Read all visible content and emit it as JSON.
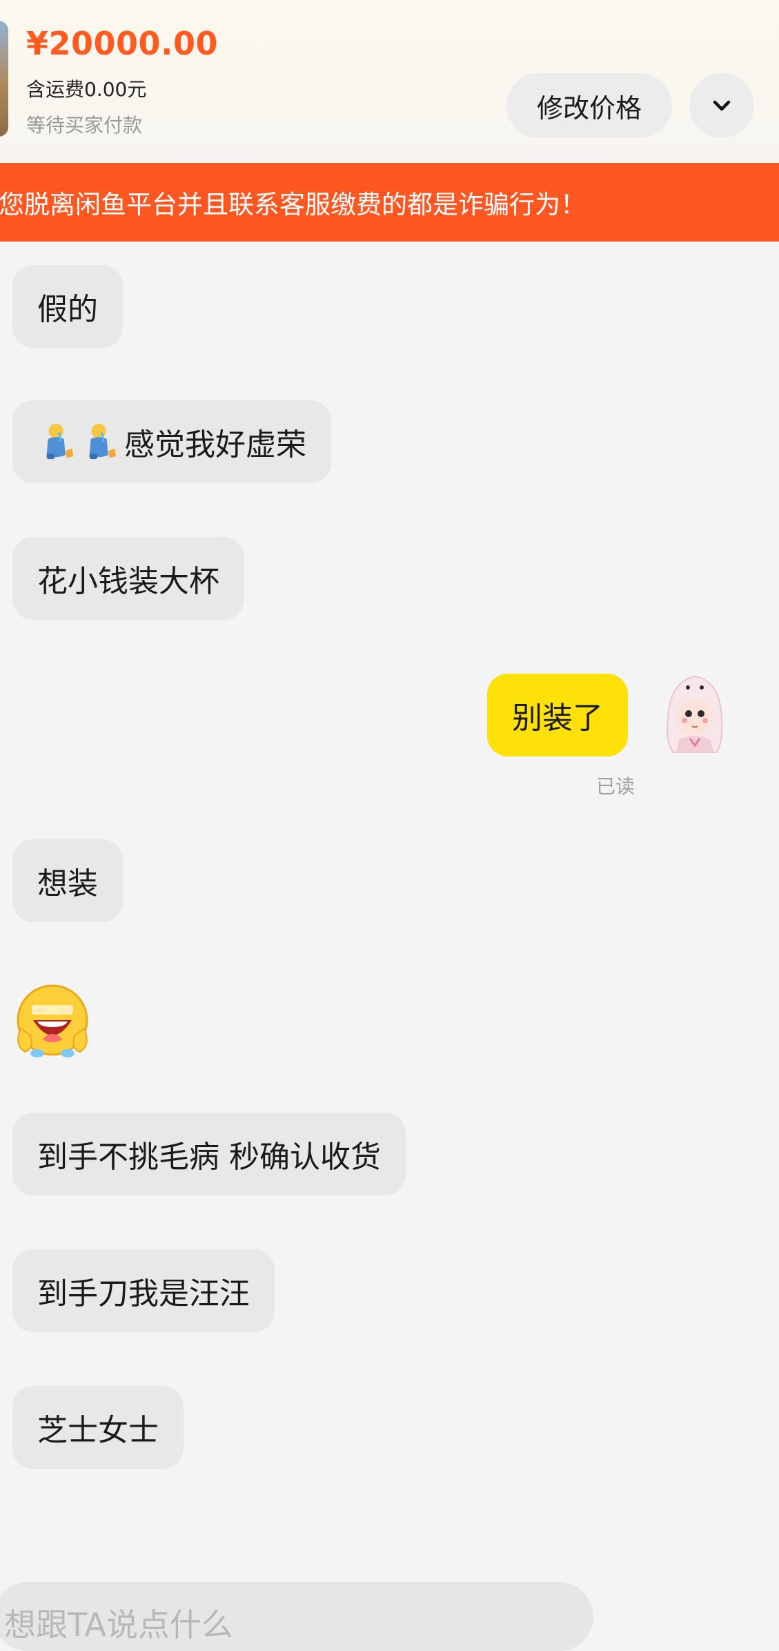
{
  "order": {
    "price": "¥20000.00",
    "shipping": "含运费0.00元",
    "status": "等待买家付款",
    "edit_price_label": "修改价格",
    "expand_icon": "chevron-down-icon"
  },
  "banner": {
    "text": "您脱离闲鱼平台并且联系客服缴费的都是诈骗行为！"
  },
  "messages": [
    {
      "side": "left",
      "text": "假的"
    },
    {
      "side": "left",
      "emoji": [
        "crying-person-emoji",
        "crying-person-emoji"
      ],
      "text": "感觉我好虚荣"
    },
    {
      "side": "left",
      "text": "花小钱装大杯"
    },
    {
      "side": "right",
      "text": "别装了",
      "receipt": "已读"
    },
    {
      "side": "left",
      "text": "想装"
    },
    {
      "side": "left",
      "emoji": [
        "grinning-tears-emoji"
      ]
    },
    {
      "side": "left",
      "text": "到手不挑毛病 秒确认收货"
    },
    {
      "side": "left",
      "text": "到手刀我是汪汪"
    },
    {
      "side": "left",
      "text": "芝士女士"
    }
  ],
  "input": {
    "placeholder": "想跟TA说点什么"
  },
  "colors": {
    "accent": "#ff5a1f",
    "banner": "#ff5722",
    "my_bubble": "#ffe10a",
    "their_bubble": "#e8e8e9"
  }
}
